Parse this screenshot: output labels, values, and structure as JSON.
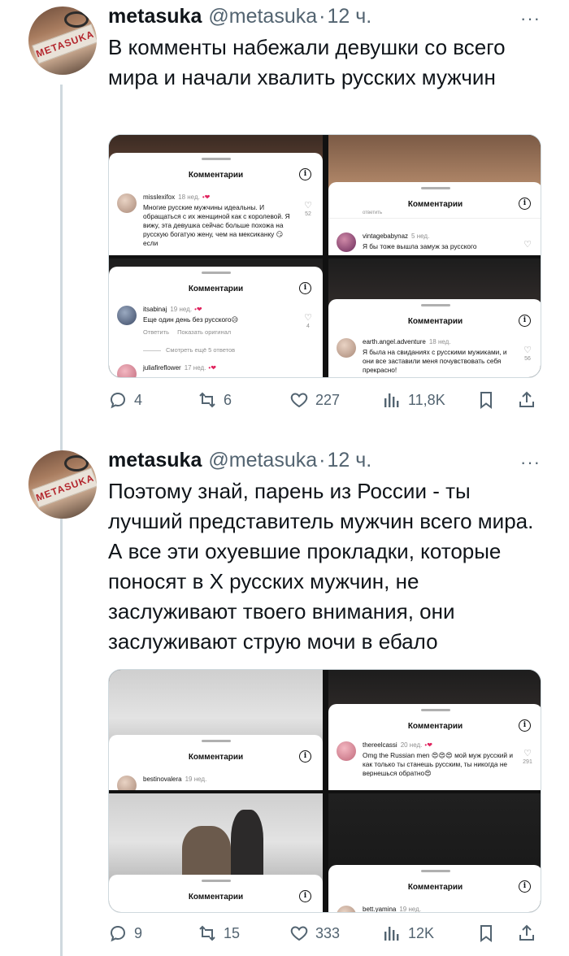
{
  "tweets": [
    {
      "author": {
        "name": "metasuka",
        "handle": "@metasuka",
        "time": "12 ч.",
        "avatar_text": "METASUKA"
      },
      "text": "В комменты набежали девушки со всего мира и начали хвалить русских мужчин",
      "media": {
        "sheet_title": "Комментарии",
        "panels": [
          {
            "comments": [
              {
                "user": "misslexifox",
                "when": "18 нед.",
                "text": "Многие русские мужчины идеальны. И обращаться с их женщиной как с королевой. Я вижу, эта девушка сейчас больше похожа на русскую богатую жену, чем на мексиканку 😏 если",
                "likes": "52"
              }
            ]
          },
          {
            "partial": "ответить",
            "comments": [
              {
                "user": "vintagebabynaz",
                "when": "5 нед.",
                "text": "Я бы тоже вышла замуж за русского",
                "likes": ""
              }
            ]
          },
          {
            "comments": [
              {
                "user": "itsabinaj",
                "when": "19 нед.",
                "text": "Еще один день без русского😥",
                "likes": "4",
                "reply": "Ответить",
                "translate": "Показать оригинал"
              },
              {
                "user": "juliafireflower",
                "when": "17 нед.",
                "text": "",
                "likes": ""
              }
            ],
            "more_replies": "Смотреть ещё 5 ответов"
          },
          {
            "comments": [
              {
                "user": "earth.angel.adventure",
                "when": "18 нед.",
                "text": "Я была на свиданиях с русскими мужиками, и они все заставили меня почувствовать себя прекрасно!",
                "likes": "56"
              }
            ]
          }
        ]
      },
      "counts": {
        "replies": "4",
        "retweets": "6",
        "likes": "227",
        "views": "11,8K"
      }
    },
    {
      "author": {
        "name": "metasuka",
        "handle": "@metasuka",
        "time": "12 ч.",
        "avatar_text": "METASUKA"
      },
      "text": "Поэтому знай, парень из России - ты лучший представитель мужчин всего мира. А все эти охуевшие прокладки, которые поносят в X русских мужчин, не заслуживают твоего внимания, они заслуживают струю мочи в ебало",
      "media": {
        "sheet_title": "Комментарии",
        "panels": [
          {
            "comments": [
              {
                "user": "bestinovalera",
                "when": "19 нед.",
                "text": "",
                "likes": ""
              }
            ]
          },
          {
            "comments": [
              {
                "user": "thereelcassi",
                "when": "20 нед.",
                "text": "Omg the Russian men 😍😍😍 мой муж русский и как только ты станешь русским, ты никогда не вернешься обратно😍",
                "likes": "291"
              }
            ]
          },
          {
            "comments": [
              {
                "user": "",
                "when": "",
                "text": "",
                "likes": ""
              }
            ]
          },
          {
            "comments": [
              {
                "user": "bett.yamina",
                "when": "19 нед.",
                "text": "",
                "likes": ""
              }
            ]
          }
        ]
      },
      "counts": {
        "replies": "9",
        "retweets": "15",
        "likes": "333",
        "views": "12K"
      }
    }
  ],
  "icons": {
    "reply": "reply-icon",
    "retweet": "retweet-icon",
    "like": "heart-icon",
    "views": "views-icon",
    "bookmark": "bookmark-icon",
    "share": "share-icon",
    "more": "more-icon",
    "info": "info-icon"
  },
  "colors": {
    "text": "#0f1419",
    "secondary": "#536471",
    "thread_line": "#cfd9de",
    "heart": "#e0245e"
  }
}
